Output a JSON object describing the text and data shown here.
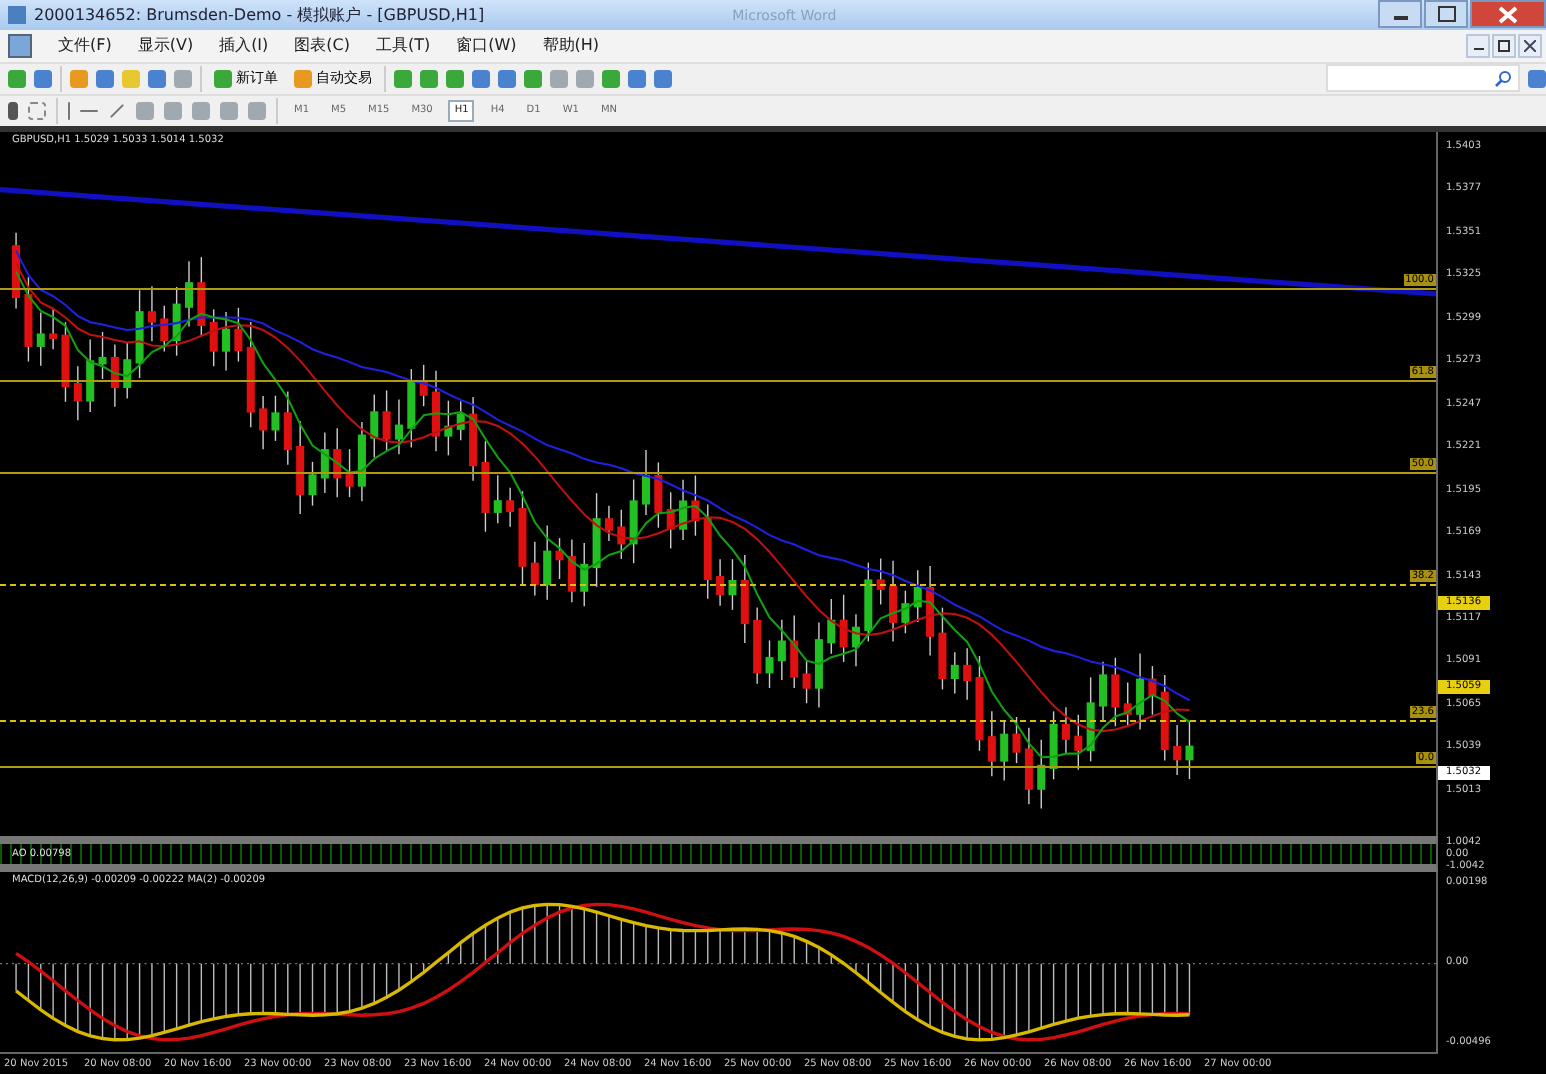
{
  "window": {
    "title": "2000134652: Brumsden-Demo - 模拟账户 - [GBPUSD,H1]",
    "faded_title": "Microsoft Word"
  },
  "menu": [
    {
      "label": "文件(F)"
    },
    {
      "label": "显示(V)"
    },
    {
      "label": "插入(I)"
    },
    {
      "label": "图表(C)"
    },
    {
      "label": "工具(T)"
    },
    {
      "label": "窗口(W)"
    },
    {
      "label": "帮助(H)"
    }
  ],
  "toolbar": {
    "text_buttons": [
      {
        "label": "新订单"
      },
      {
        "label": "自动交易"
      }
    ],
    "periods": [
      {
        "label": "M1",
        "selected": false
      },
      {
        "label": "M5",
        "selected": false
      },
      {
        "label": "M15",
        "selected": false
      },
      {
        "label": "M30",
        "selected": false
      },
      {
        "label": "H1",
        "selected": true
      },
      {
        "label": "H4",
        "selected": false
      },
      {
        "label": "D1",
        "selected": false
      },
      {
        "label": "W1",
        "selected": false
      },
      {
        "label": "MN",
        "selected": false
      }
    ]
  },
  "chart": {
    "header": "GBPUSD,H1 1.5029 1.5033 1.5014 1.5032",
    "price_labels": [
      "1.5403",
      "1.5377",
      "1.5351",
      "1.5325",
      "1.5299",
      "1.5273",
      "1.5247",
      "1.5221",
      "1.5195",
      "1.5169",
      "1.5143",
      "1.5117",
      "1.5091",
      "1.5065",
      "1.5039",
      "1.5013"
    ],
    "fib_levels": [
      {
        "label": "100.0",
        "kind": "solid"
      },
      {
        "label": "61.8",
        "kind": "solid"
      },
      {
        "label": "50.0",
        "kind": "solid"
      },
      {
        "label": "38.2",
        "kind": "dashed"
      },
      {
        "label": "23.6",
        "kind": "dashed"
      },
      {
        "label": "0.0",
        "kind": "solid"
      }
    ],
    "marked_prices": [
      {
        "label": "1.5136",
        "kind": "level"
      },
      {
        "label": "1.5059",
        "kind": "level"
      },
      {
        "label": "1.5032",
        "kind": "bid"
      }
    ],
    "strip": {
      "header": "AO 0.00798",
      "labels": [
        "1.0042",
        "0.00",
        "-1.0042"
      ]
    },
    "macd": {
      "header": "MACD(12,26,9) -0.00209 -0.00222 MA(2) -0.00209",
      "labels": [
        "0.00198",
        "0.00",
        "-0.00496"
      ]
    },
    "time_labels": [
      "20 Nov 2015",
      "20 Nov 08:00",
      "20 Nov 16:00",
      "23 Nov 00:00",
      "23 Nov 08:00",
      "23 Nov 16:00",
      "24 Nov 00:00",
      "24 Nov 08:00",
      "24 Nov 16:00",
      "25 Nov 00:00",
      "25 Nov 08:00",
      "25 Nov 16:00",
      "26 Nov 00:00",
      "26 Nov 08:00",
      "26 Nov 16:00",
      "27 Nov 00:00"
    ]
  }
}
